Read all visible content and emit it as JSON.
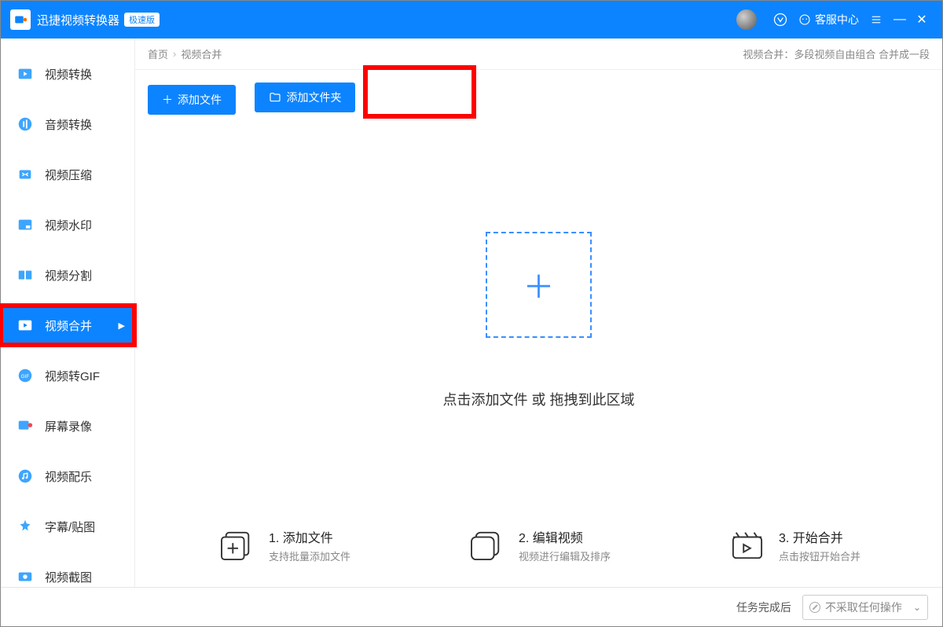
{
  "app": {
    "title": "迅捷视频转换器",
    "badge": "极速版",
    "support": "客服中心"
  },
  "sidebar": {
    "items": [
      {
        "label": "视频转换"
      },
      {
        "label": "音频转换"
      },
      {
        "label": "视频压缩"
      },
      {
        "label": "视频水印"
      },
      {
        "label": "视频分割"
      },
      {
        "label": "视频合并"
      },
      {
        "label": "视频转GIF"
      },
      {
        "label": "屏幕录像"
      },
      {
        "label": "视频配乐"
      },
      {
        "label": "字幕/贴图"
      },
      {
        "label": "视频截图"
      }
    ]
  },
  "breadcrumb": {
    "root": "首页",
    "current": "视频合并",
    "desc": "视频合并：多段视频自由组合 合并成一段"
  },
  "buttons": {
    "add_file": "添加文件",
    "add_folder": "添加文件夹"
  },
  "drop": {
    "hint": "点击添加文件 或 拖拽到此区域"
  },
  "steps": [
    {
      "title": "1. 添加文件",
      "sub": "支持批量添加文件"
    },
    {
      "title": "2. 编辑视频",
      "sub": "视频进行编辑及排序"
    },
    {
      "title": "3. 开始合并",
      "sub": "点击按钮开始合并"
    }
  ],
  "footer": {
    "label": "任务完成后",
    "action": "不采取任何操作"
  }
}
